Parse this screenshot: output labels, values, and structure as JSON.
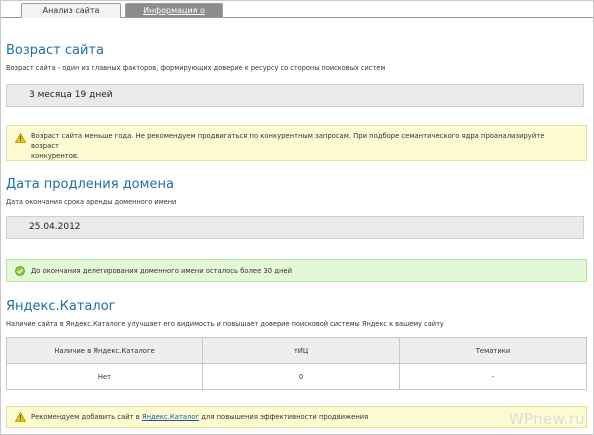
{
  "tabs": [
    {
      "label": "Анализ сайта",
      "active": true
    },
    {
      "label": "Информация о страницах",
      "active": false
    }
  ],
  "age": {
    "title": "Возраст сайта",
    "description": "Возраст сайта - один из главных факторов, формирующих доверие к ресурсу со стороны поисковых систем",
    "value": "3 месяца 19 дней",
    "alert_line1": "Возраст сайта меньше года. Не рекомендуем продвигаться по конкурентным запросам. При подборе семантического ядра проанализируйте возраст",
    "alert_line2": "конкурентов."
  },
  "domain": {
    "title": "Дата продления домена",
    "description": "Дата окончания срока аренды доменного имени",
    "value": "25.04.2012",
    "alert": "До окончания делегирования доменного имени осталось более 30 дней"
  },
  "yandex": {
    "title": "Яндекс.Каталог",
    "description": "Наличие сайта в Яндекс.Каталоге улучшает его видимость и повышает доверие поисковой системы Яндекс к вашему сайту",
    "columns": [
      "Наличие в Яндекс.Каталоге",
      "тИЦ",
      "Тематики"
    ],
    "row": [
      "Нет",
      "0",
      "-"
    ],
    "alert_before": "Рекомендуем добавить сайт в",
    "alert_link": "Яндекс.Каталог",
    "alert_after": "для повышения эффективности продвижения"
  },
  "watermark": "WPnew.ru",
  "colors": {
    "heading": "#1d6fa5",
    "warn_bg": "#fdfbd2",
    "ok_bg": "#e3f8d6",
    "tab_inactive": "#8c8c8c"
  },
  "icons": {
    "warning": "warning-icon",
    "ok": "check-icon"
  }
}
